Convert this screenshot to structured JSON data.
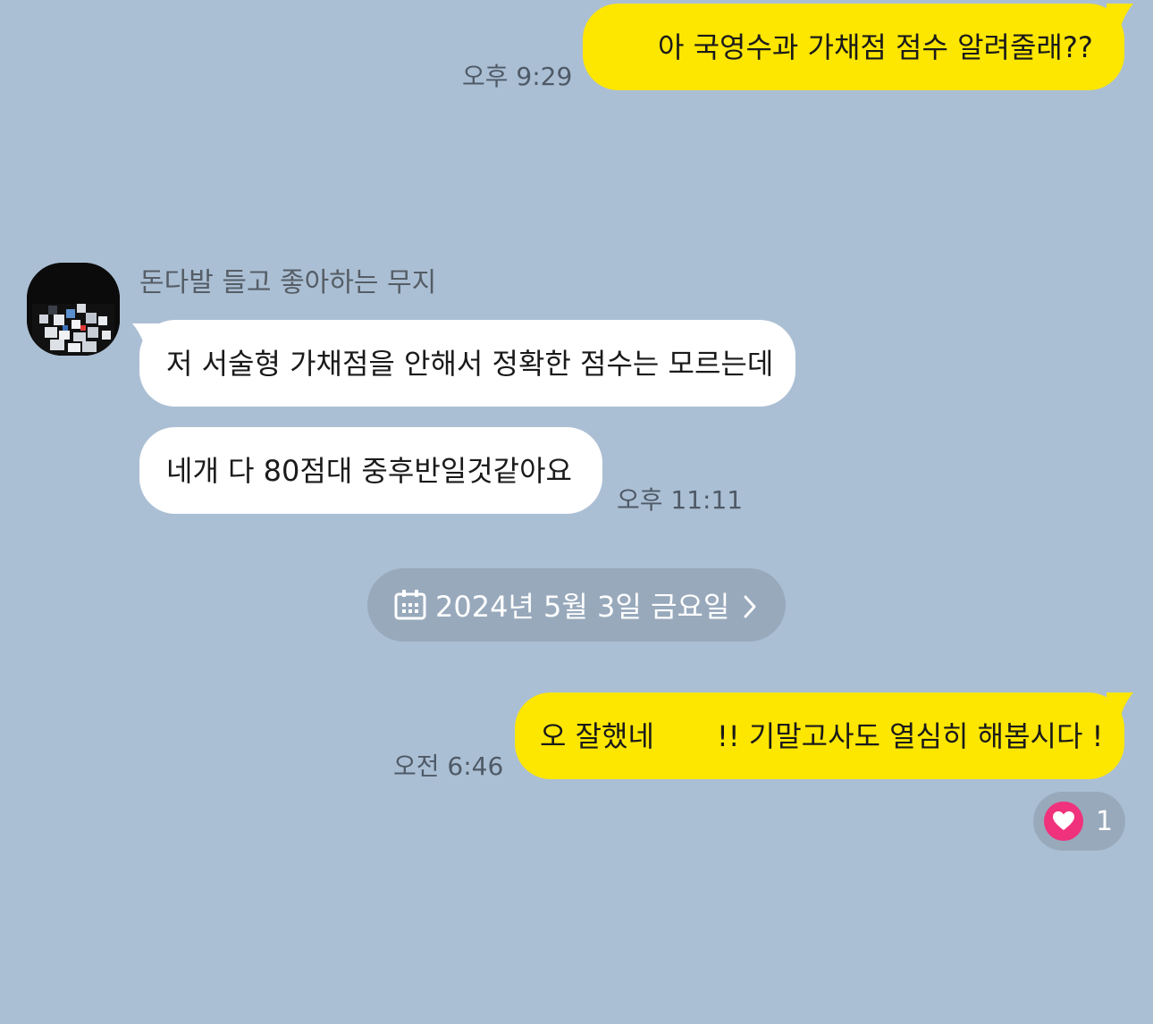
{
  "colors": {
    "background": "#abbfd4",
    "my_bubble": "#fde600",
    "their_bubble": "#ffffff",
    "timestamp": "#4f5a67",
    "chip": "#98a9bc",
    "reaction_heart": "#f0317c"
  },
  "messages": {
    "m1": {
      "text": "아 국영수과 가채점 점수 알려줄래??",
      "time": "오후 9:29"
    },
    "sender": {
      "name": "돈다발 들고 좋아하는 무지"
    },
    "m2": {
      "text": "저 서술형 가채점을 안해서 정확한 점수는 모르는데"
    },
    "m3": {
      "text": "네개 다 80점대 중후반일것같아요",
      "time": "오후 11:11"
    },
    "date_divider": {
      "text": "2024년 5월 3일 금요일",
      "icon": "calendar-icon",
      "chevron": "›"
    },
    "m4": {
      "text_a": "오 잘했네",
      "text_b": "!! 기말고사도 열심히 해봅시다 !",
      "time": "오전 6:46"
    },
    "reaction": {
      "icon": "heart-icon",
      "count": "1"
    }
  }
}
